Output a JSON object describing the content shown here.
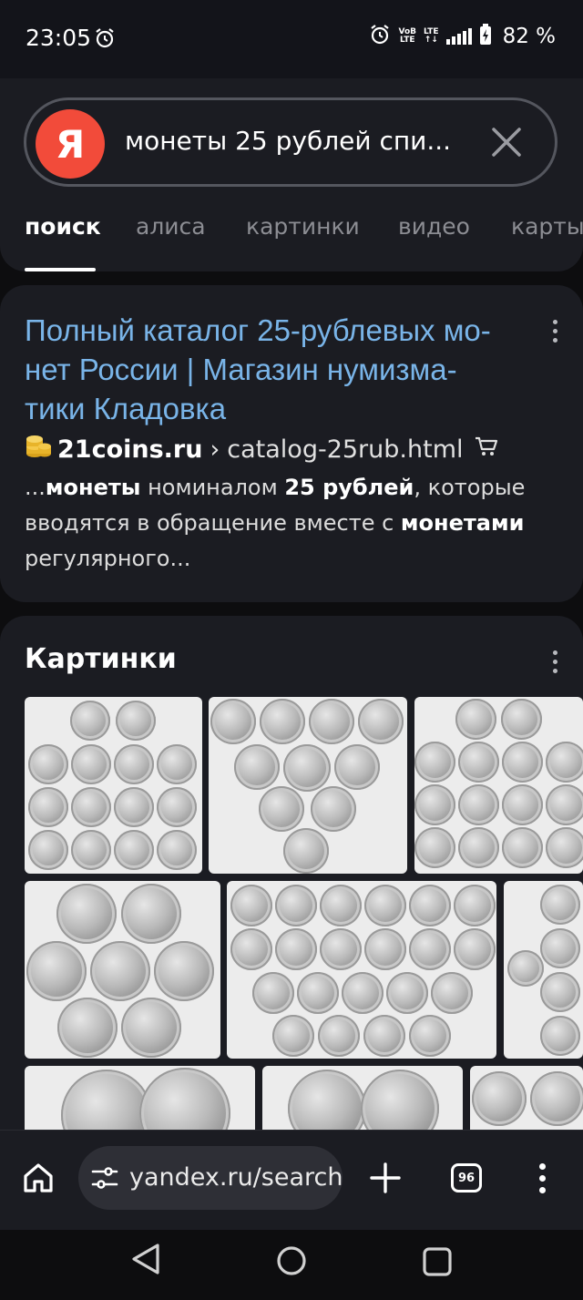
{
  "status_bar": {
    "time": "23:05",
    "network_label_top": "VoB",
    "network_label_bottom": "LTE",
    "network_type": "LTE",
    "battery": "82 %",
    "icons": [
      "alarm-icon",
      "alarm-icon",
      "signal-icon",
      "battery-charging-icon"
    ]
  },
  "search": {
    "logo": "Я",
    "query": "монеты 25 рублей спи...",
    "clear_icon": "close-icon"
  },
  "tabs": [
    {
      "label": "поиск",
      "active": true
    },
    {
      "label": "алиса",
      "active": false
    },
    {
      "label": "картинки",
      "active": false
    },
    {
      "label": "видео",
      "active": false
    },
    {
      "label": "карты",
      "active": false
    }
  ],
  "result": {
    "title": "Полный каталог 25-рублевых монет России | Магазин нумизматики Кладовка",
    "title_lines": [
      "Полный каталог 25-рублевых мо-",
      "нет России | Магазин нумизма-",
      "тики Кладовка"
    ],
    "favicon": "coins-icon",
    "domain": "21coins.ru",
    "separator": "›",
    "path": "catalog-25rub.html",
    "snippet_parts": [
      {
        "text": "...",
        "bold": false
      },
      {
        "text": "монеты",
        "bold": true
      },
      {
        "text": " номиналом ",
        "bold": false
      },
      {
        "text": "25 рублей",
        "bold": true
      },
      {
        "text": ", которые вводятся в обращение вместе с ",
        "bold": false
      },
      {
        "text": "монетами",
        "bold": true
      },
      {
        "text": " регулярного...",
        "bold": false
      }
    ]
  },
  "images_section": {
    "title": "Картинки",
    "tiles": 9
  },
  "browser_bar": {
    "url": "yandex.ru/search",
    "tab_count": "96"
  },
  "colors": {
    "background": "#0d0d0f",
    "card": "#1b1c22",
    "link": "#79b4e8",
    "yandex_red": "#f24b3a"
  }
}
